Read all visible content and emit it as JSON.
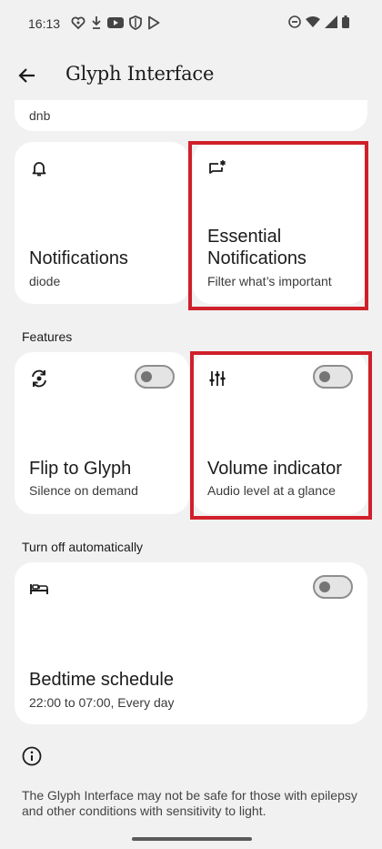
{
  "status_bar": {
    "time": "16:13",
    "left_icons": [
      "heart-badge-icon",
      "download-arrow-icon",
      "youtube-icon",
      "shield-icon",
      "play-store-icon"
    ],
    "right_icons": [
      "do-not-disturb-icon",
      "wifi-icon",
      "signal-icon",
      "battery-icon"
    ]
  },
  "app_bar": {
    "title": "Glyph Interface"
  },
  "partial_card": {
    "subtitle": "dnb"
  },
  "cards": {
    "notifications": {
      "title": "Notifications",
      "subtitle": "diode",
      "icon": "bell-icon"
    },
    "essential": {
      "title_line1": "Essential",
      "title_line2": "Notifications",
      "subtitle": "Filter what’s important",
      "icon": "notification-star-icon"
    }
  },
  "features": {
    "label": "Features",
    "flip": {
      "title": "Flip to Glyph",
      "subtitle": "Silence on demand",
      "icon": "flip-sync-icon",
      "toggle_on": false
    },
    "volume": {
      "title": "Volume indicator",
      "subtitle": "Audio level at a glance",
      "icon": "sliders-icon",
      "toggle_on": false
    }
  },
  "turn_off": {
    "label": "Turn off automatically",
    "bedtime": {
      "title": "Bedtime schedule",
      "subtitle": "22:00 to 07:00, Every day",
      "icon": "bed-icon",
      "toggle_on": false
    }
  },
  "disclaimer": {
    "icon": "info-icon",
    "text": "The Glyph Interface may not be safe for those with epilepsy and other conditions with sensitivity to light."
  },
  "colors": {
    "highlight": "#d0202a",
    "background": "#f1f1f1",
    "card": "#ffffff"
  }
}
